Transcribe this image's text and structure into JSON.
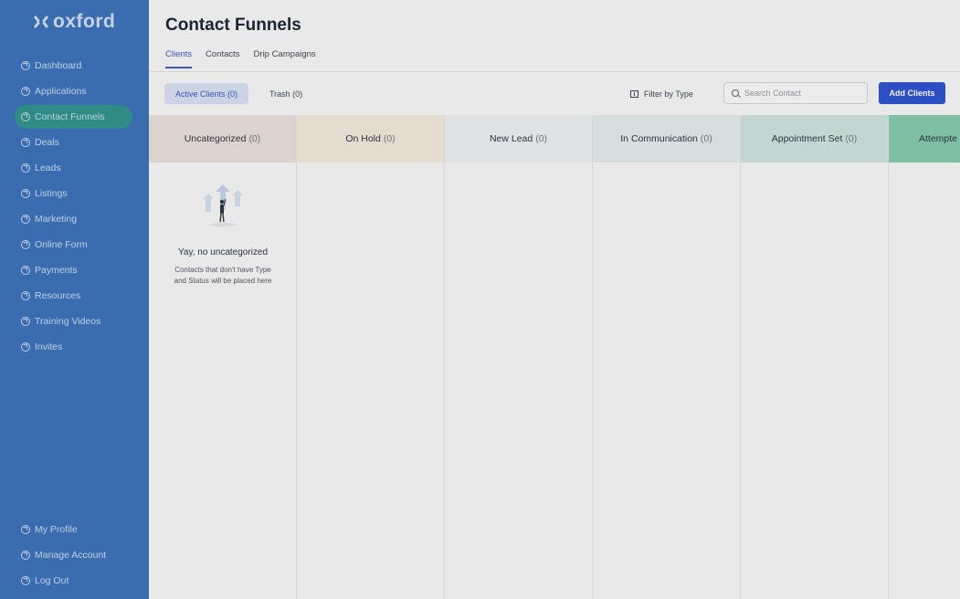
{
  "brand": {
    "name": "oxford"
  },
  "sidebar": {
    "items": [
      {
        "label": "Dashboard"
      },
      {
        "label": "Applications"
      },
      {
        "label": "Contact Funnels"
      },
      {
        "label": "Deals"
      },
      {
        "label": "Leads"
      },
      {
        "label": "Listings"
      },
      {
        "label": "Marketing"
      },
      {
        "label": "Online Form"
      },
      {
        "label": "Payments"
      },
      {
        "label": "Resources"
      },
      {
        "label": "Training Videos"
      },
      {
        "label": "Invites"
      }
    ],
    "bottom_items": [
      {
        "label": "My Profile"
      },
      {
        "label": "Manage Account"
      },
      {
        "label": "Log Out"
      }
    ],
    "active": "Contact Funnels"
  },
  "page": {
    "title": "Contact Funnels"
  },
  "tabs": [
    {
      "label": "Clients",
      "active": true
    },
    {
      "label": "Contacts"
    },
    {
      "label": "Drip Campaigns"
    }
  ],
  "toolbar": {
    "active_clients": "Active Clients (0)",
    "trash": "Trash (0)",
    "filter": "Filter by Type",
    "search_placeholder": "Search Contact",
    "add_button": "Add Clients"
  },
  "columns": [
    {
      "name": "Uncategorized",
      "count": "(0)",
      "color": "#e6ddd9"
    },
    {
      "name": "On Hold",
      "count": "(0)",
      "color": "#ebe3d8"
    },
    {
      "name": "New Lead",
      "count": "(0)",
      "color": "#e1e4e4"
    },
    {
      "name": "In Communication",
      "count": "(0)",
      "color": "#dde3e2"
    },
    {
      "name": "Appointment Set",
      "count": "(0)",
      "color": "#cfdcd8"
    },
    {
      "name": "Attempte",
      "count": "",
      "color": "#8fc6ad"
    }
  ],
  "empty_state": {
    "title": "Yay, no uncategorized",
    "description": "Contacts that don't have Type and Status will be placed here"
  }
}
